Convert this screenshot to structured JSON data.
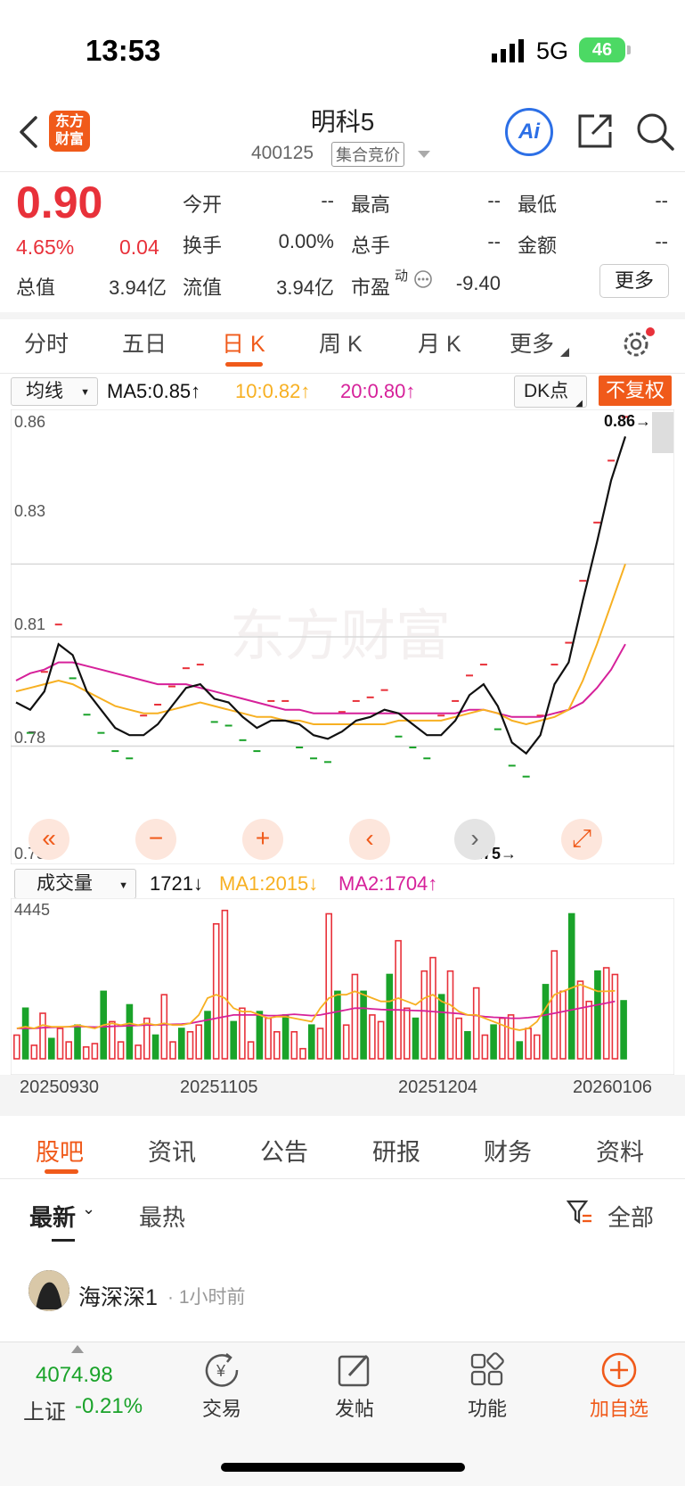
{
  "status": {
    "time": "13:53",
    "network": "5G",
    "battery": "46"
  },
  "header": {
    "title": "明科5",
    "code": "400125",
    "badge": "集合竞价",
    "logo_line1": "东方",
    "logo_line2": "财富",
    "ai_label": "Ai"
  },
  "quote": {
    "price": "0.90",
    "change_pct": "4.65%",
    "change": "0.04",
    "fields": [
      {
        "label": "今开",
        "value": "--"
      },
      {
        "label": "最高",
        "value": "--"
      },
      {
        "label": "最低",
        "value": "--"
      },
      {
        "label": "换手",
        "value": "0.00%"
      },
      {
        "label": "总手",
        "value": "--"
      },
      {
        "label": "金额",
        "value": "--"
      },
      {
        "label": "总值",
        "value": "3.94亿"
      },
      {
        "label": "流值",
        "value": "3.94亿"
      },
      {
        "label": "市盈",
        "value": "-9.40"
      }
    ],
    "pe_sup": "动",
    "more_label": "更多"
  },
  "period_tabs": [
    "分时",
    "五日",
    "日 K",
    "周 K",
    "月 K",
    "更多"
  ],
  "ma_bar": {
    "selector": "均线",
    "ma5": "MA5:0.85↑",
    "ma10": "10:0.82↑",
    "ma20": "20:0.80↑",
    "dk": "DK点",
    "fuquan": "不复权"
  },
  "price_chart": {
    "y_labels": [
      "0.86",
      "0.83",
      "0.81",
      "0.78",
      "0.75"
    ],
    "high_label": "0.86→",
    "low_label": "0.75→",
    "watermark": "东方财富",
    "colors": {
      "up": "#e8313a",
      "down": "#1aa32a",
      "close": "#111111",
      "ma10": "#f7b022",
      "ma20": "#d6219a"
    }
  },
  "vol_bar": {
    "selector": "成交量",
    "vol": "1721↓",
    "ma1": "MA1:2015↓",
    "ma2": "MA2:1704↑",
    "max": "4445"
  },
  "chart_data": {
    "type": "line",
    "title": "",
    "ylim": [
      0.75,
      0.87
    ],
    "closes": [
      0.792,
      0.79,
      0.795,
      0.808,
      0.805,
      0.795,
      0.79,
      0.785,
      0.783,
      0.783,
      0.786,
      0.791,
      0.796,
      0.797,
      0.793,
      0.792,
      0.788,
      0.785,
      0.787,
      0.787,
      0.786,
      0.783,
      0.782,
      0.784,
      0.787,
      0.788,
      0.79,
      0.789,
      0.786,
      0.783,
      0.783,
      0.787,
      0.794,
      0.797,
      0.791,
      0.781,
      0.778,
      0.783,
      0.797,
      0.803,
      0.82,
      0.836,
      0.853,
      0.865
    ],
    "ma10": [
      0.795,
      0.796,
      0.797,
      0.798,
      0.797,
      0.795,
      0.793,
      0.791,
      0.79,
      0.789,
      0.789,
      0.79,
      0.791,
      0.792,
      0.791,
      0.79,
      0.789,
      0.788,
      0.788,
      0.787,
      0.787,
      0.786,
      0.786,
      0.786,
      0.786,
      0.786,
      0.786,
      0.787,
      0.787,
      0.787,
      0.787,
      0.788,
      0.789,
      0.79,
      0.789,
      0.787,
      0.786,
      0.787,
      0.788,
      0.79,
      0.798,
      0.808,
      0.819,
      0.83
    ],
    "ma20": [
      0.798,
      0.8,
      0.801,
      0.803,
      0.803,
      0.802,
      0.801,
      0.8,
      0.799,
      0.798,
      0.797,
      0.797,
      0.797,
      0.796,
      0.795,
      0.794,
      0.793,
      0.792,
      0.791,
      0.79,
      0.79,
      0.789,
      0.789,
      0.789,
      0.789,
      0.789,
      0.789,
      0.789,
      0.789,
      0.789,
      0.789,
      0.789,
      0.79,
      0.79,
      0.789,
      0.788,
      0.788,
      0.788,
      0.789,
      0.79,
      0.792,
      0.796,
      0.801,
      0.808
    ],
    "volume": [
      700,
      1500,
      400,
      1350,
      600,
      900,
      500,
      1000,
      350,
      450,
      2000,
      1100,
      500,
      1600,
      400,
      1200,
      700,
      1900,
      500,
      900,
      800,
      1000,
      1400,
      4000,
      4400,
      1100,
      1500,
      500,
      1400,
      1200,
      800,
      1300,
      800,
      300,
      1000,
      900,
      4300,
      2000,
      1000,
      2500,
      2000,
      1300,
      1100,
      2500,
      3500,
      1500,
      1200,
      2600,
      3000,
      1900,
      2600,
      1200,
      800,
      2100,
      700,
      1000,
      1200,
      1300,
      500,
      900,
      700,
      2200,
      3200,
      2000,
      4300,
      2300,
      1700,
      2600,
      2700,
      2500,
      1721
    ],
    "vol_ma1": [
      900,
      950,
      900,
      1000,
      950,
      950,
      950,
      1000,
      950,
      900,
      1000,
      1050,
      1000,
      1050,
      1000,
      1050,
      1000,
      1050,
      1000,
      1000,
      1050,
      1300,
      1800,
      1900,
      1800,
      1500,
      1400,
      1400,
      1300,
      1200,
      1250,
      1250,
      1200,
      1150,
      1100,
      1500,
      1800,
      1900,
      1900,
      2000,
      1900,
      1800,
      1700,
      1700,
      1800,
      1700,
      1600,
      1800,
      1900,
      1700,
      1600,
      1400,
      1300,
      1300,
      1200,
      1100,
      1000,
      900,
      850,
      900,
      1100,
      1500,
      1900,
      2000,
      2100,
      2200,
      2100,
      2000,
      2000,
      2015
    ],
    "vol_ma2": [
      900,
      900,
      900,
      920,
      930,
      940,
      950,
      960,
      950,
      940,
      950,
      960,
      970,
      980,
      990,
      1000,
      1000,
      1010,
      1020,
      1030,
      1050,
      1100,
      1150,
      1200,
      1250,
      1300,
      1300,
      1300,
      1300,
      1280,
      1280,
      1300,
      1320,
      1300,
      1280,
      1300,
      1350,
      1400,
      1450,
      1500,
      1500,
      1480,
      1460,
      1450,
      1450,
      1440,
      1430,
      1420,
      1400,
      1380,
      1360,
      1340,
      1300,
      1280,
      1250,
      1230,
      1220,
      1200,
      1200,
      1220,
      1250,
      1300,
      1350,
      1400,
      1450,
      1500,
      1550,
      1600,
      1650,
      1704
    ]
  },
  "date_labels": [
    "20250930",
    "20251105",
    "20251204",
    "20260106"
  ],
  "feed_tabs": [
    "股吧",
    "资讯",
    "公告",
    "研报",
    "财务",
    "资料"
  ],
  "sort": {
    "latest": "最新",
    "hot": "最热",
    "filter": "全部"
  },
  "post": {
    "user": "海深深1",
    "time": "· 1小时前"
  },
  "bottom_bar": {
    "index_value": "4074.98",
    "index_name": "上证",
    "index_change": "-0.21%",
    "trade": "交易",
    "post": "发帖",
    "func": "功能",
    "watch": "加自选"
  }
}
